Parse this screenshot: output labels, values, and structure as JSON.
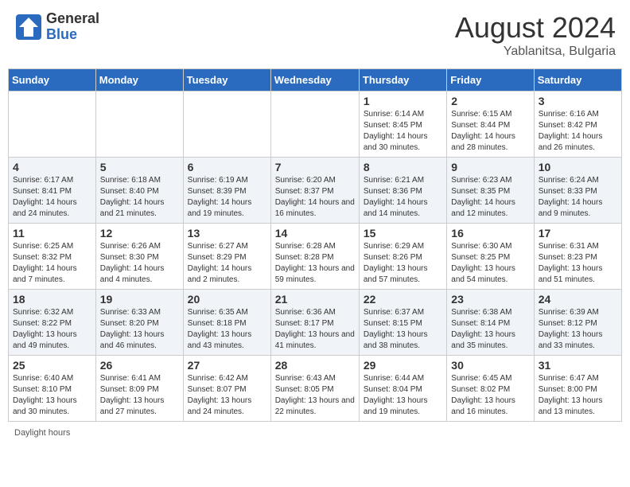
{
  "header": {
    "logo_general": "General",
    "logo_blue": "Blue",
    "month_year": "August 2024",
    "location": "Yablanitsa, Bulgaria"
  },
  "footer": {
    "daylight_label": "Daylight hours"
  },
  "days_of_week": [
    "Sunday",
    "Monday",
    "Tuesday",
    "Wednesday",
    "Thursday",
    "Friday",
    "Saturday"
  ],
  "weeks": [
    [
      {
        "day": "",
        "info": ""
      },
      {
        "day": "",
        "info": ""
      },
      {
        "day": "",
        "info": ""
      },
      {
        "day": "",
        "info": ""
      },
      {
        "day": "1",
        "info": "Sunrise: 6:14 AM\nSunset: 8:45 PM\nDaylight: 14 hours and 30 minutes."
      },
      {
        "day": "2",
        "info": "Sunrise: 6:15 AM\nSunset: 8:44 PM\nDaylight: 14 hours and 28 minutes."
      },
      {
        "day": "3",
        "info": "Sunrise: 6:16 AM\nSunset: 8:42 PM\nDaylight: 14 hours and 26 minutes."
      }
    ],
    [
      {
        "day": "4",
        "info": "Sunrise: 6:17 AM\nSunset: 8:41 PM\nDaylight: 14 hours and 24 minutes."
      },
      {
        "day": "5",
        "info": "Sunrise: 6:18 AM\nSunset: 8:40 PM\nDaylight: 14 hours and 21 minutes."
      },
      {
        "day": "6",
        "info": "Sunrise: 6:19 AM\nSunset: 8:39 PM\nDaylight: 14 hours and 19 minutes."
      },
      {
        "day": "7",
        "info": "Sunrise: 6:20 AM\nSunset: 8:37 PM\nDaylight: 14 hours and 16 minutes."
      },
      {
        "day": "8",
        "info": "Sunrise: 6:21 AM\nSunset: 8:36 PM\nDaylight: 14 hours and 14 minutes."
      },
      {
        "day": "9",
        "info": "Sunrise: 6:23 AM\nSunset: 8:35 PM\nDaylight: 14 hours and 12 minutes."
      },
      {
        "day": "10",
        "info": "Sunrise: 6:24 AM\nSunset: 8:33 PM\nDaylight: 14 hours and 9 minutes."
      }
    ],
    [
      {
        "day": "11",
        "info": "Sunrise: 6:25 AM\nSunset: 8:32 PM\nDaylight: 14 hours and 7 minutes."
      },
      {
        "day": "12",
        "info": "Sunrise: 6:26 AM\nSunset: 8:30 PM\nDaylight: 14 hours and 4 minutes."
      },
      {
        "day": "13",
        "info": "Sunrise: 6:27 AM\nSunset: 8:29 PM\nDaylight: 14 hours and 2 minutes."
      },
      {
        "day": "14",
        "info": "Sunrise: 6:28 AM\nSunset: 8:28 PM\nDaylight: 13 hours and 59 minutes."
      },
      {
        "day": "15",
        "info": "Sunrise: 6:29 AM\nSunset: 8:26 PM\nDaylight: 13 hours and 57 minutes."
      },
      {
        "day": "16",
        "info": "Sunrise: 6:30 AM\nSunset: 8:25 PM\nDaylight: 13 hours and 54 minutes."
      },
      {
        "day": "17",
        "info": "Sunrise: 6:31 AM\nSunset: 8:23 PM\nDaylight: 13 hours and 51 minutes."
      }
    ],
    [
      {
        "day": "18",
        "info": "Sunrise: 6:32 AM\nSunset: 8:22 PM\nDaylight: 13 hours and 49 minutes."
      },
      {
        "day": "19",
        "info": "Sunrise: 6:33 AM\nSunset: 8:20 PM\nDaylight: 13 hours and 46 minutes."
      },
      {
        "day": "20",
        "info": "Sunrise: 6:35 AM\nSunset: 8:18 PM\nDaylight: 13 hours and 43 minutes."
      },
      {
        "day": "21",
        "info": "Sunrise: 6:36 AM\nSunset: 8:17 PM\nDaylight: 13 hours and 41 minutes."
      },
      {
        "day": "22",
        "info": "Sunrise: 6:37 AM\nSunset: 8:15 PM\nDaylight: 13 hours and 38 minutes."
      },
      {
        "day": "23",
        "info": "Sunrise: 6:38 AM\nSunset: 8:14 PM\nDaylight: 13 hours and 35 minutes."
      },
      {
        "day": "24",
        "info": "Sunrise: 6:39 AM\nSunset: 8:12 PM\nDaylight: 13 hours and 33 minutes."
      }
    ],
    [
      {
        "day": "25",
        "info": "Sunrise: 6:40 AM\nSunset: 8:10 PM\nDaylight: 13 hours and 30 minutes."
      },
      {
        "day": "26",
        "info": "Sunrise: 6:41 AM\nSunset: 8:09 PM\nDaylight: 13 hours and 27 minutes."
      },
      {
        "day": "27",
        "info": "Sunrise: 6:42 AM\nSunset: 8:07 PM\nDaylight: 13 hours and 24 minutes."
      },
      {
        "day": "28",
        "info": "Sunrise: 6:43 AM\nSunset: 8:05 PM\nDaylight: 13 hours and 22 minutes."
      },
      {
        "day": "29",
        "info": "Sunrise: 6:44 AM\nSunset: 8:04 PM\nDaylight: 13 hours and 19 minutes."
      },
      {
        "day": "30",
        "info": "Sunrise: 6:45 AM\nSunset: 8:02 PM\nDaylight: 13 hours and 16 minutes."
      },
      {
        "day": "31",
        "info": "Sunrise: 6:47 AM\nSunset: 8:00 PM\nDaylight: 13 hours and 13 minutes."
      }
    ]
  ]
}
